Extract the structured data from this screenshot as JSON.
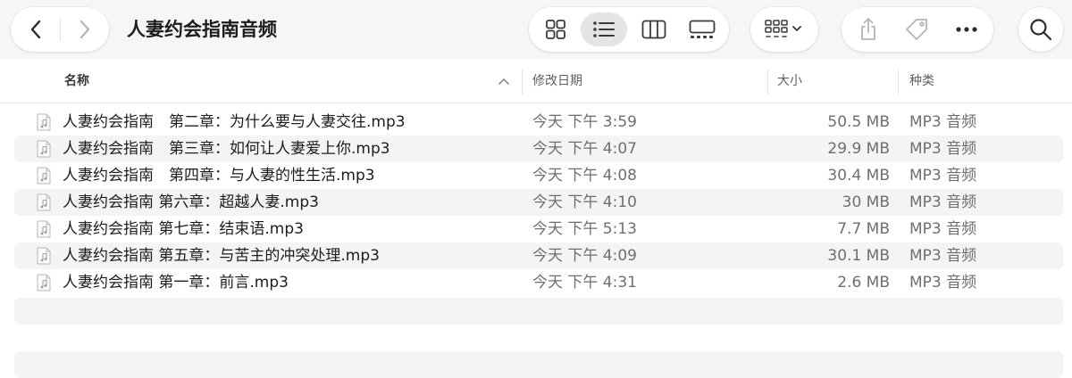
{
  "window": {
    "title": "人妻约会指南音频"
  },
  "toolbar": {
    "back_icon": "chevron-left-icon",
    "forward_icon": "chevron-right-icon",
    "views": [
      "grid-view-icon",
      "list-view-icon",
      "column-view-icon",
      "gallery-view-icon"
    ],
    "active_view": "list",
    "group_icon": "group-by-icon",
    "share_icon": "share-icon",
    "tag_icon": "tag-icon",
    "more_icon": "more-icon",
    "search_icon": "search-icon"
  },
  "columns": {
    "name": "名称",
    "date": "修改日期",
    "size": "大小",
    "kind": "种类",
    "sort_direction": "ascending"
  },
  "files": [
    {
      "name": "人妻约会指南　第二章：为什么要与人妻交往.mp3",
      "date": "今天 下午 3:59",
      "size": "50.5 MB",
      "kind": "MP3 音频"
    },
    {
      "name": "人妻约会指南　第三章：如何让人妻爱上你.mp3",
      "date": "今天 下午 4:07",
      "size": "29.9 MB",
      "kind": "MP3 音频"
    },
    {
      "name": "人妻约会指南　第四章：与人妻的性生活.mp3",
      "date": "今天 下午 4:08",
      "size": "30.4 MB",
      "kind": "MP3 音频"
    },
    {
      "name": "人妻约会指南 第六章：超越人妻.mp3",
      "date": "今天 下午 4:10",
      "size": "30 MB",
      "kind": "MP3 音频"
    },
    {
      "name": "人妻约会指南 第七章：结束语.mp3",
      "date": "今天 下午 5:13",
      "size": "7.7 MB",
      "kind": "MP3 音频"
    },
    {
      "name": "人妻约会指南 第五章：与苦主的冲突处理.mp3",
      "date": "今天 下午 4:09",
      "size": "30.1 MB",
      "kind": "MP3 音频"
    },
    {
      "name": "人妻约会指南 第一章：前言.mp3",
      "date": "今天 下午 4:31",
      "size": "2.6 MB",
      "kind": "MP3 音频"
    }
  ],
  "colors": {
    "toolbar_bg": "#f6f6f6",
    "alt_row": "#f4f4f5",
    "active_view_bg": "#e4e4e6",
    "secondary_text": "#6e6e73"
  }
}
